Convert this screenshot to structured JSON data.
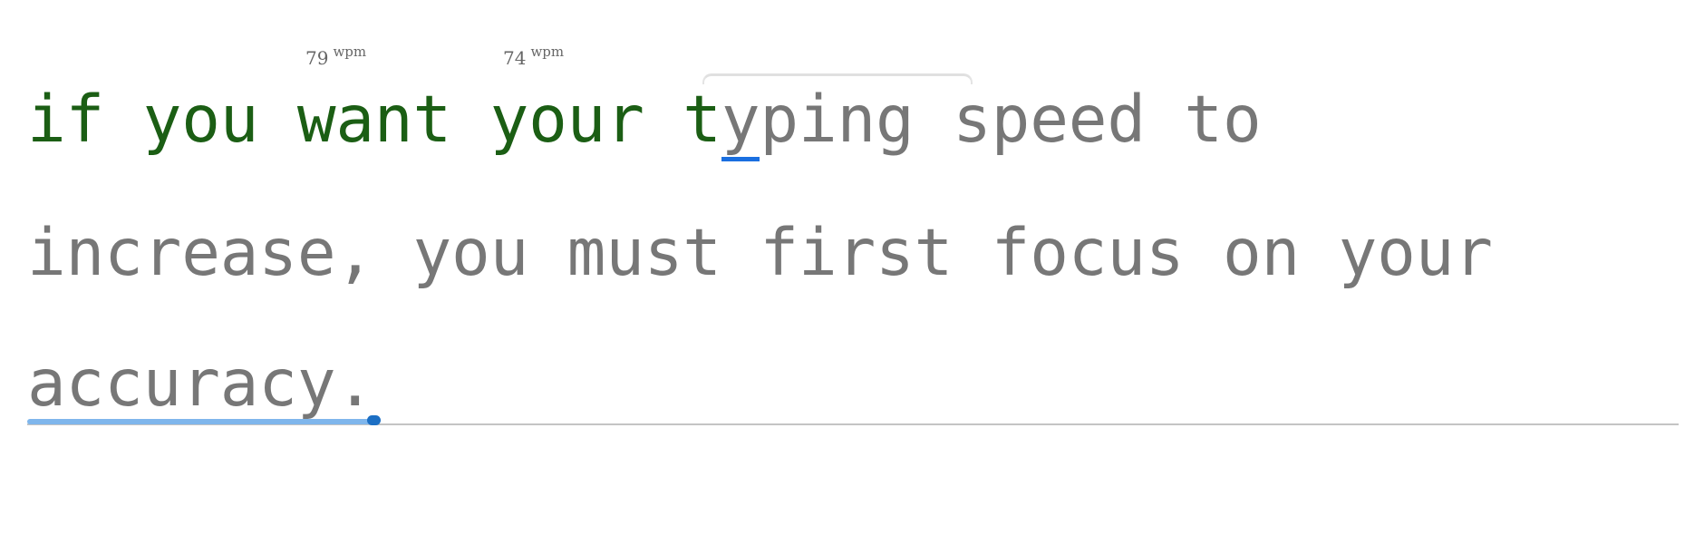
{
  "lines": [
    "if you want your typing speed to ",
    "increase, you must first focus on your ",
    "accuracy."
  ],
  "typed_char_count": 18,
  "cursor_char_index": 18,
  "wpm_markers": [
    {
      "value": "79",
      "unit": "wpm",
      "word": "want"
    },
    {
      "value": "74",
      "unit": "wpm",
      "word": "your"
    }
  ],
  "progress_fraction": 0.21,
  "colors": {
    "typed_text": "#1b5e14",
    "typed_bg": "#e6f7da",
    "pending_text": "#777777",
    "cursor": "#1a6fe0",
    "progress": "#7fb6ec",
    "progress_knob": "#1c6fc4"
  }
}
